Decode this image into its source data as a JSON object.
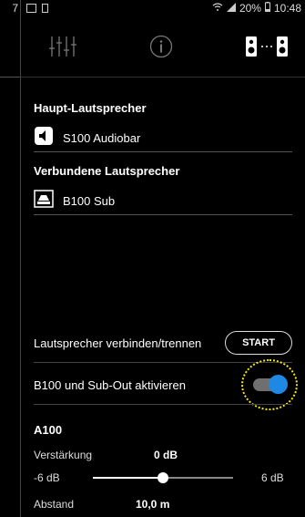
{
  "left_screen": {
    "time": "7"
  },
  "statusbar": {
    "battery": "20%",
    "time": "10:48"
  },
  "toolbar": {
    "equalizer": "equalizer-icon",
    "info": "info-icon",
    "speakers": "speaker-link-icon"
  },
  "main_speaker": {
    "title": "Haupt-Lautsprecher",
    "name": "S100 Audiobar"
  },
  "connected_speakers": {
    "title": "Verbundene Lautsprecher",
    "name": "B100 Sub"
  },
  "connect": {
    "label": "Lautsprecher verbinden/trennen",
    "button": "START"
  },
  "subout": {
    "label": "B100 und Sub-Out aktivieren",
    "enabled": true
  },
  "a100": {
    "title": "A100",
    "gain_label": "Verstärkung",
    "gain_value": "0 dB",
    "gain_min": "-6 dB",
    "gain_max": "6 dB",
    "gain_level": 0.5,
    "distance_label": "Abstand",
    "distance_value": "10,0 m"
  },
  "colors": {
    "accent": "#1e88e5",
    "highlight": "#f5e61a"
  }
}
